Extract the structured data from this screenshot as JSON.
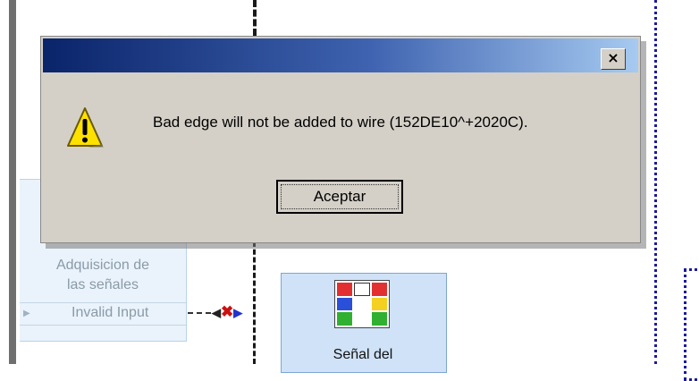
{
  "dialog": {
    "title": "",
    "message": "Bad edge will not be added to wire (152DE10^+2020C).",
    "ok_label": "Aceptar",
    "close_glyph": "×",
    "icon": "warning-icon"
  },
  "background": {
    "acq_title_line1": "Adquisicion de",
    "acq_title_line2": "las señales",
    "acq_terminal": "Invalid Input",
    "senal_label": "Señal del",
    "colors": {
      "titlebar_start": "#0a246a",
      "titlebar_end": "#a6caf0",
      "dialog_face": "#d4d0c8",
      "broken_wire_x": "#cc1111"
    }
  }
}
